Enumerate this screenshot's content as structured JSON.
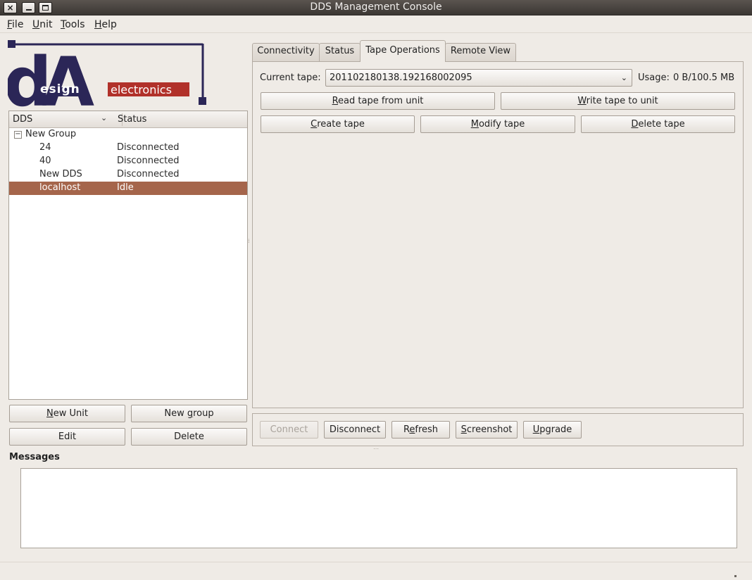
{
  "window": {
    "title": "DDS Management Console"
  },
  "menubar": {
    "items": [
      "File",
      "Unit",
      "Tools",
      "Help"
    ]
  },
  "logo": {
    "letters": "dA",
    "word1": "esign",
    "word2": "electronics"
  },
  "tree": {
    "columns": [
      "DDS",
      "Status"
    ],
    "group": {
      "expander": "−",
      "label": "New Group"
    },
    "rows": [
      {
        "name": "24",
        "status": "Disconnected",
        "selected": false
      },
      {
        "name": "40",
        "status": "Disconnected",
        "selected": false
      },
      {
        "name": "New DDS",
        "status": "Disconnected",
        "selected": false
      },
      {
        "name": "localhost",
        "status": "Idle",
        "selected": true
      }
    ]
  },
  "left_buttons": {
    "new_unit": {
      "mn": "N",
      "rest": "ew Unit"
    },
    "new_group": {
      "pre": "New ",
      "mn": "g",
      "rest": "roup"
    },
    "edit": "Edit",
    "delete": "Delete"
  },
  "tabs": [
    {
      "label": "Connectivity",
      "active": false
    },
    {
      "label": "Status",
      "active": false
    },
    {
      "label": "Tape Operations",
      "active": true
    },
    {
      "label": "Remote View",
      "active": false
    }
  ],
  "tape_ops": {
    "current_tape_label": "Current tape:",
    "current_tape_value": "201102180138.192168002095",
    "usage_label": "Usage:",
    "usage_value": "0 B/100.5 MB",
    "read": {
      "mn": "R",
      "rest": "ead tape from unit"
    },
    "write": {
      "mn": "W",
      "rest": "rite tape to unit"
    },
    "create": {
      "mn": "C",
      "rest": "reate tape"
    },
    "modify": {
      "mn": "M",
      "rest": "odify tape"
    },
    "delete": {
      "mn": "D",
      "rest": "elete tape"
    }
  },
  "actions": {
    "connect": {
      "label": "Connect",
      "disabled": true
    },
    "disconnect": {
      "label": "Disconnect"
    },
    "refresh": {
      "pre": "R",
      "mn": "e",
      "rest": "fresh"
    },
    "screenshot": {
      "mn": "S",
      "rest": "creenshot"
    },
    "upgrade": {
      "mn": "U",
      "rest": "pgrade"
    }
  },
  "messages": {
    "label": "Messages",
    "content": ""
  },
  "colors": {
    "selection": "#a5654b",
    "logo_navy": "#2b2657",
    "logo_red": "#b1312a"
  },
  "icons": {
    "close": "×",
    "combo_arrow": "⌄",
    "sort_arrow": "⌄"
  }
}
